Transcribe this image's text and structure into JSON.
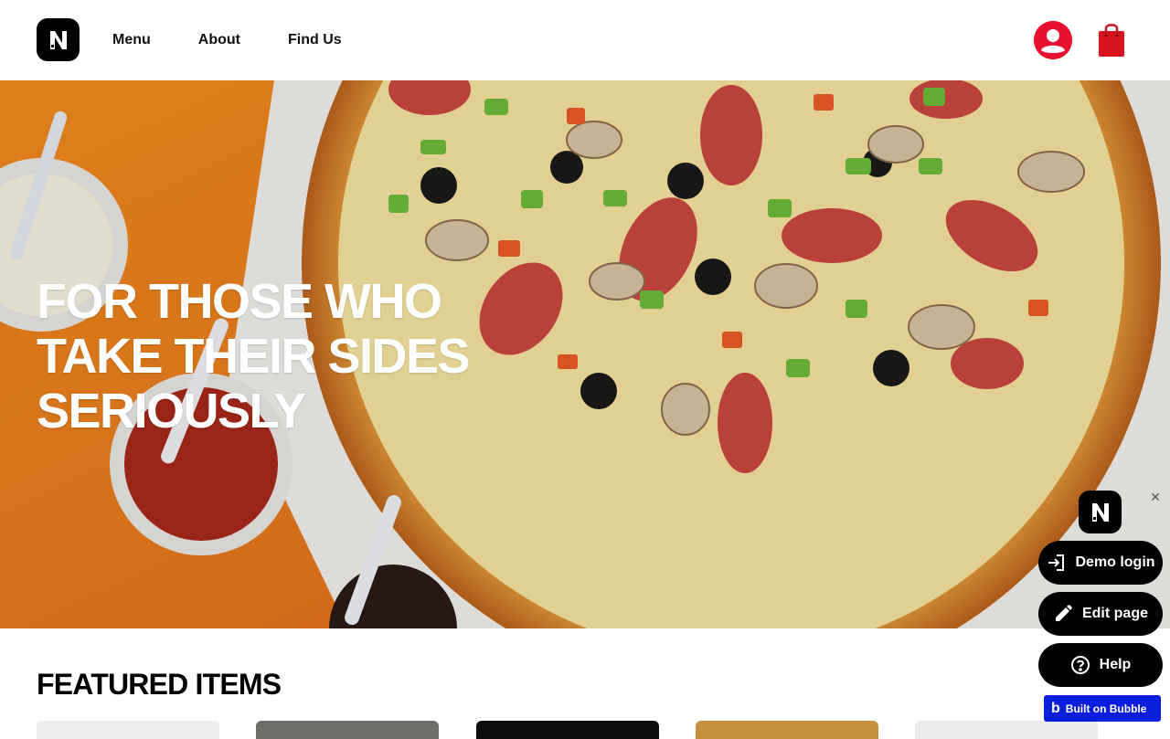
{
  "header": {
    "nav": [
      {
        "label": "Menu"
      },
      {
        "label": "About"
      },
      {
        "label": "Find Us"
      }
    ],
    "logo_icon": "n-logo-icon",
    "user_icon": "user-account-icon",
    "cart_icon": "shopping-bag-icon",
    "accent_color": "#e8112d"
  },
  "hero": {
    "title": "FOR THOSE WHO TAKE THEIR SIDES SERIOUSLY"
  },
  "featured": {
    "title": "FEATURED ITEMS"
  },
  "widget": {
    "close_label": "✕",
    "demo_login_label": "Demo login",
    "edit_page_label": "Edit page",
    "help_label": "Help",
    "built_on_label": "Built on Bubble",
    "built_on_mark": "b"
  }
}
